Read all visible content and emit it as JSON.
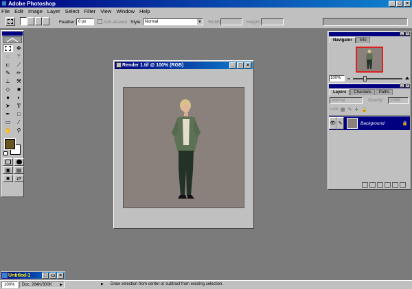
{
  "app": {
    "title": "Adobe Photoshop"
  },
  "menu": [
    "File",
    "Edit",
    "Image",
    "Layer",
    "Select",
    "Filter",
    "View",
    "Window",
    "Help"
  ],
  "options": {
    "feather_label": "Feather:",
    "feather_value": "0 px",
    "anti_aliased_label": "Anti-aliased",
    "style_label": "Style:",
    "style_value": "Normal",
    "width_label": "Width:",
    "height_label": "Height:"
  },
  "document": {
    "title": "Render 1.tif @ 100% (RGB)"
  },
  "navigator": {
    "tabs": [
      "Navigator",
      "Info"
    ],
    "zoom": "100%"
  },
  "layers": {
    "tabs": [
      "Layers",
      "Channels",
      "Paths"
    ],
    "blend_mode": "Normal",
    "opacity_label": "Opacity:",
    "opacity_value": "100%",
    "lock_label": "Lock:",
    "items": [
      {
        "name": "Background"
      }
    ]
  },
  "minimized_window": {
    "title": "Untitled-1"
  },
  "status": {
    "zoom": "100%",
    "doc_size": "Doc: 264K/300K",
    "hint": "Draw selection from center or subtract from existing selection."
  },
  "colors": {
    "title_bar": "#000080",
    "foreground": "#685420",
    "background": "#ffffff",
    "workspace": "#7b7b7b"
  },
  "icons": [
    "marquee-icon",
    "move-icon",
    "lasso-icon",
    "magic-wand-icon",
    "crop-icon",
    "slice-icon",
    "brush-icon",
    "pencil-icon",
    "stamp-icon",
    "history-brush-icon",
    "eraser-icon",
    "gradient-icon",
    "blur-icon",
    "dodge-icon",
    "path-select-icon",
    "type-icon",
    "pen-icon",
    "shape-icon",
    "notes-icon",
    "eyedropper-icon",
    "hand-icon",
    "zoom-icon",
    "eye-icon"
  ]
}
